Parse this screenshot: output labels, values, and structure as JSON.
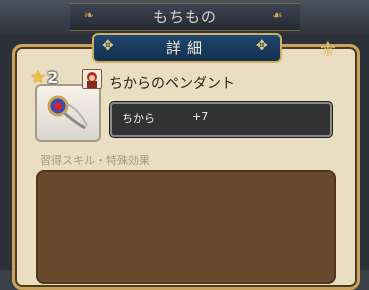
{
  "screen": {
    "background_title": "もちもの"
  },
  "dialog": {
    "tab_label": "詳細"
  },
  "item": {
    "rarity": "2",
    "name": "ちからのペンダント",
    "stats": [
      {
        "label": "ちから",
        "value": "+7"
      }
    ]
  },
  "skills": {
    "section_label": "習得スキル・特殊効果"
  },
  "colors": {
    "panel_bg": "#e9dec2",
    "tab_bg": "#1e466f",
    "gold": "#cfae63",
    "stat_bg": "#323232",
    "skill_bg": "#6a4a2c"
  }
}
